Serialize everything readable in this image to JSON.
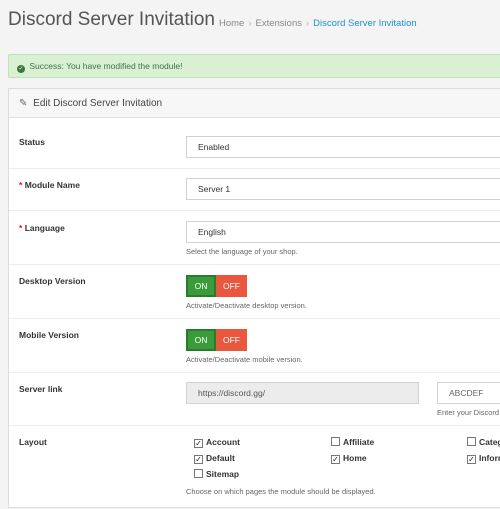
{
  "header": {
    "title": "Discord Server Invitation",
    "breadcrumb": [
      "Home",
      "Extensions",
      "Discord Server Invitation"
    ]
  },
  "alert": {
    "message": "Success: You have modified the module!"
  },
  "panel": {
    "heading": "Edit Discord Server Invitation",
    "status": {
      "label": "Status",
      "value": "Enabled"
    },
    "module_name": {
      "label": "Module Name",
      "value": "Server 1"
    },
    "language": {
      "label": "Language",
      "value": "English",
      "help": "Select the language of your shop."
    },
    "desktop": {
      "label": "Desktop Version",
      "on_label": "ON",
      "off_label": "OFF",
      "enabled": true,
      "help": "Activate/Deactivate desktop version."
    },
    "mobile": {
      "label": "Mobile Version",
      "on_label": "ON",
      "off_label": "OFF",
      "enabled": true,
      "help": "Activate/Deactivate mobile version."
    },
    "server_link": {
      "label": "Server link",
      "prefix": "https://discord.gg/",
      "code_placeholder": "ABCDEF",
      "code_help": "Enter your Discord"
    },
    "layout": {
      "label": "Layout",
      "options": [
        {
          "label": "Account",
          "checked": true
        },
        {
          "label": "Affiliate",
          "checked": false
        },
        {
          "label": "Categ",
          "checked": false
        },
        {
          "label": "Default",
          "checked": true
        },
        {
          "label": "Home",
          "checked": true
        },
        {
          "label": "Inforr",
          "checked": true
        },
        {
          "label": "Sitemap",
          "checked": false
        }
      ],
      "help": "Choose on which pages the module should be displayed."
    }
  }
}
